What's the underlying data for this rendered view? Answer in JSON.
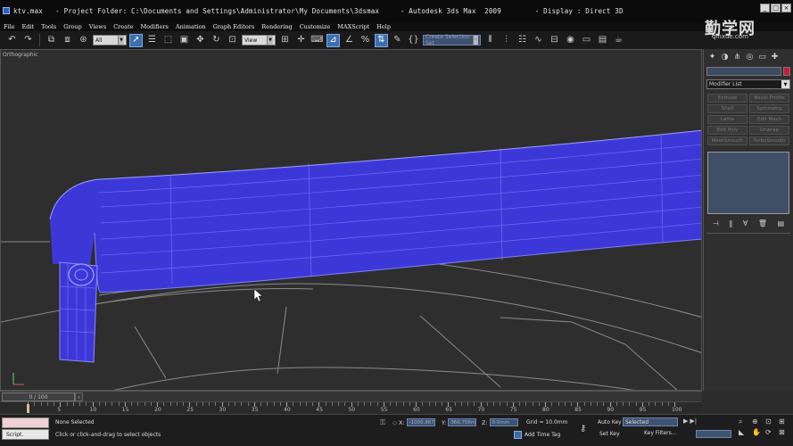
{
  "window": {
    "title": "ktv.max   - Project Folder: C:\\Documents and Settings\\Administrator\\My Documents\\3dsmax     - Autodesk 3ds Max  2009        - Display : Direct 3D"
  },
  "menu": [
    "File",
    "Edit",
    "Tools",
    "Group",
    "Views",
    "Create",
    "Modifiers",
    "Animation",
    "Graph Editors",
    "Rendering",
    "Customize",
    "MAXScript",
    "Help"
  ],
  "toolbar": {
    "filter_select": "All",
    "refcoord_select": "View",
    "named_selection": "Create Selection Set"
  },
  "viewport": {
    "label": "Orthographic"
  },
  "command_panel": {
    "modifier_list": "Modifier List",
    "modifier_buttons": [
      "Extrude",
      "Bevel Profile",
      "Shell",
      "Symmetry",
      "Lathe",
      "Edit Mesh",
      "Edit Poly",
      "Unwrap",
      "MeshSmooth",
      "TurboSmooth"
    ]
  },
  "timeline": {
    "frame_indicator": "0 / 100",
    "ticks": [
      "5",
      "10",
      "15",
      "20",
      "25",
      "30",
      "35",
      "40",
      "45",
      "50",
      "55",
      "60",
      "65",
      "70",
      "75",
      "80",
      "85",
      "90",
      "95",
      "100"
    ]
  },
  "status": {
    "script_label": "Script.",
    "selection": "None Selected",
    "prompt": "Click or click-and-drag to select objects",
    "x_value": "-1000.867m",
    "y_value": "366.756mm",
    "z_value": "0.0mm",
    "x_label": "X:",
    "y_label": "Y:",
    "z_label": "Z:",
    "grid": "Grid = 10.0mm",
    "add_time_tag": "Add Time Tag",
    "auto_key": "Auto Key",
    "set_key": "Set Key",
    "autokey_select": "Selected",
    "key_filters": "Key Filters..."
  },
  "watermark": {
    "main": "勤学网",
    "sub": "qinxue.com"
  },
  "colors": {
    "object": "#3c38d8",
    "wire": "#8c8cff",
    "viewport_bg": "#2e2e2e",
    "active_tool": "#3d6fb0"
  }
}
